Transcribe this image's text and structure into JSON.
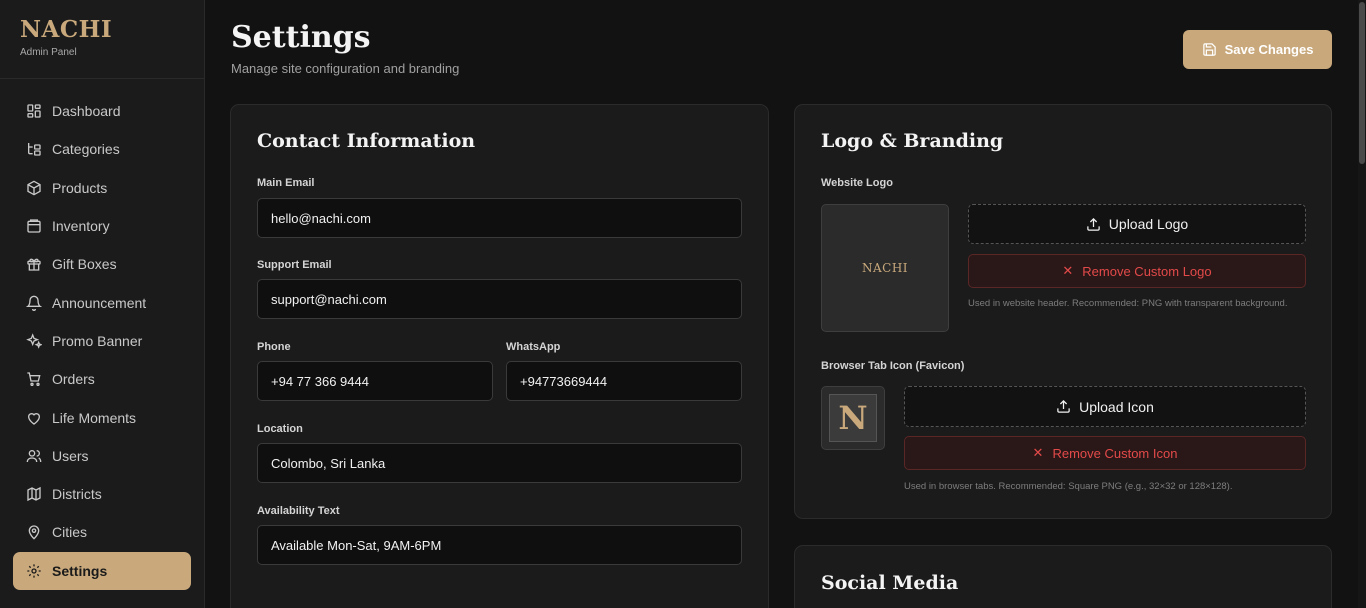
{
  "brand": {
    "name": "NACHI",
    "subtitle": "Admin Panel"
  },
  "sidebar": {
    "items": [
      {
        "label": "Dashboard",
        "icon": "dashboard-icon"
      },
      {
        "label": "Categories",
        "icon": "categories-icon"
      },
      {
        "label": "Products",
        "icon": "box-icon"
      },
      {
        "label": "Inventory",
        "icon": "archive-icon"
      },
      {
        "label": "Gift Boxes",
        "icon": "gift-icon"
      },
      {
        "label": "Announcement",
        "icon": "bell-icon"
      },
      {
        "label": "Promo Banner",
        "icon": "sparkles-icon"
      },
      {
        "label": "Orders",
        "icon": "cart-icon"
      },
      {
        "label": "Life Moments",
        "icon": "heart-icon"
      },
      {
        "label": "Users",
        "icon": "users-icon"
      },
      {
        "label": "Districts",
        "icon": "map-icon"
      },
      {
        "label": "Cities",
        "icon": "map-pin-icon"
      },
      {
        "label": "Settings",
        "icon": "gear-icon",
        "active": true
      }
    ]
  },
  "header": {
    "title": "Settings",
    "subtitle": "Manage site configuration and branding",
    "save_label": "Save Changes"
  },
  "contact": {
    "title": "Contact Information",
    "main_email_label": "Main Email",
    "main_email": "hello@nachi.com",
    "support_email_label": "Support Email",
    "support_email": "support@nachi.com",
    "phone_label": "Phone",
    "phone": "+94 77 366 9444",
    "whatsapp_label": "WhatsApp",
    "whatsapp": "+94773669444",
    "location_label": "Location",
    "location": "Colombo, Sri Lanka",
    "availability_label": "Availability Text",
    "availability": "Available Mon-Sat, 9AM-6PM"
  },
  "branding": {
    "title": "Logo & Branding",
    "logo_label": "Website Logo",
    "logo_preview_text": "NACHI",
    "upload_logo": "Upload Logo",
    "remove_logo": "Remove Custom Logo",
    "logo_hint": "Used in website header. Recommended: PNG with transparent background.",
    "favicon_label": "Browser Tab Icon (Favicon)",
    "favicon_letter": "N",
    "upload_icon": "Upload Icon",
    "remove_icon": "Remove Custom Icon",
    "favicon_hint": "Used in browser tabs. Recommended: Square PNG (e.g., 32×32 or 128×128)."
  },
  "social": {
    "title": "Social Media"
  },
  "colors": {
    "accent": "#c9a97c",
    "danger": "#e34a4a",
    "background": "#121212",
    "card": "#1b1b1b"
  }
}
